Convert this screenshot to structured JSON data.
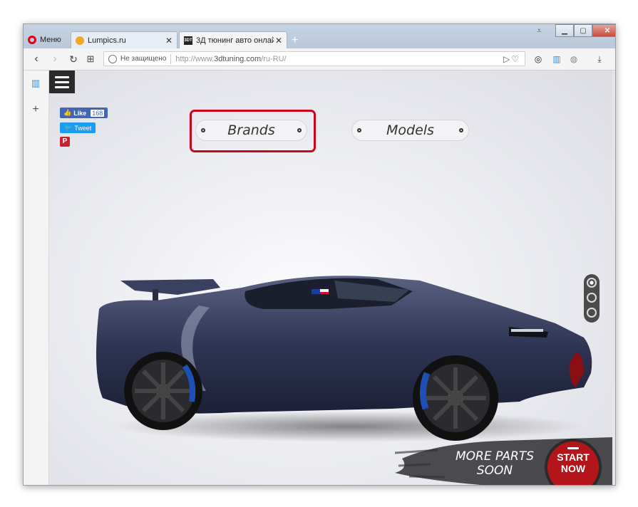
{
  "browser": {
    "menu_label": "Меню",
    "tabs": [
      {
        "title": "Lumpics.ru",
        "favicon": "orange-circle-icon",
        "active": false
      },
      {
        "title": "3Д тюнинг авто онлайн, з",
        "favicon": "3dt-logo-icon",
        "active": true
      }
    ],
    "new_tab": "+",
    "address": {
      "security_label": "Не защищено",
      "url_prefix": "http://www.",
      "url_host": "3dtuning.com",
      "url_path": "/ru-RU/"
    }
  },
  "page": {
    "social": {
      "fb_like": "Like",
      "fb_count": "168",
      "tweet": "Tweet",
      "pinterest": "P"
    },
    "selectors": [
      {
        "label": "Brands",
        "highlighted": true
      },
      {
        "label": "Models",
        "highlighted": false
      }
    ],
    "car_badge": "3DT",
    "promo": {
      "more_parts": "MORE PARTS SOON",
      "start_line1": "START",
      "start_line2": "NOW"
    },
    "view_options": 3,
    "active_view": 0
  },
  "colors": {
    "highlight_border": "#d0021b",
    "car_body": "#2f3554",
    "start_button": "#b3151b"
  }
}
